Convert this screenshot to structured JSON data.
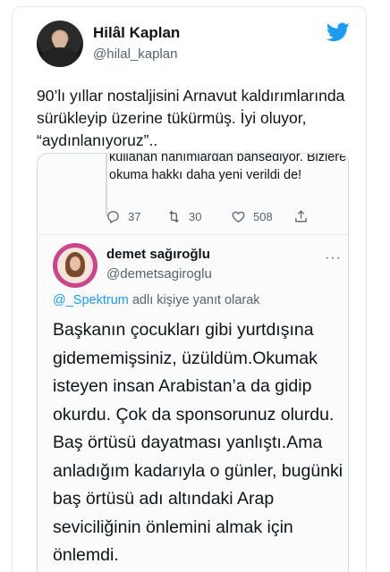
{
  "author": {
    "display_name": "Hilâl Kaplan",
    "handle": "@hilal_kaplan"
  },
  "tweet": {
    "text": "90’lı yıllar nostaljisini Arnavut kaldırımlarında sürükleyip üzerine tükürmüş. İyi oluyor, “aydınlanıyoruz”.."
  },
  "quoted_thread": {
    "previous_text": "kullanan hanımlardan bahsediyor. Bizlere okuma hakkı daha yeni verildi de!",
    "reply_count": "37",
    "retweet_count": "30",
    "like_count": "508"
  },
  "quoted_tweet": {
    "display_name": "demet sağıroğlu",
    "handle": "@demetsagiroglu",
    "more_label": "···",
    "reply_to_mention": "@_Spektrum",
    "reply_to_suffix": " adlı kişiye yanıt olarak",
    "text": "Başkanın çocukları gibi yurtdışına gidememişsiniz, üzüldüm.Okumak isteyen insan Arabistan’a da gidip okurdu. Çok da sponsorunuz olurdu. Baş örtüsü dayatması yanlıştı.Ama anladığım kadarıyla o günler, bugünki baş örtüsü adı altındaki Arap seviciliğinin önlemini almak için önlemdi."
  },
  "colors": {
    "twitter_blue": "#1d9bf0",
    "secondary_text": "#536471",
    "border": "#cfd9de"
  },
  "icons": [
    "twitter-bird-icon",
    "reply-icon",
    "retweet-icon",
    "like-icon",
    "share-icon",
    "more-icon"
  ]
}
